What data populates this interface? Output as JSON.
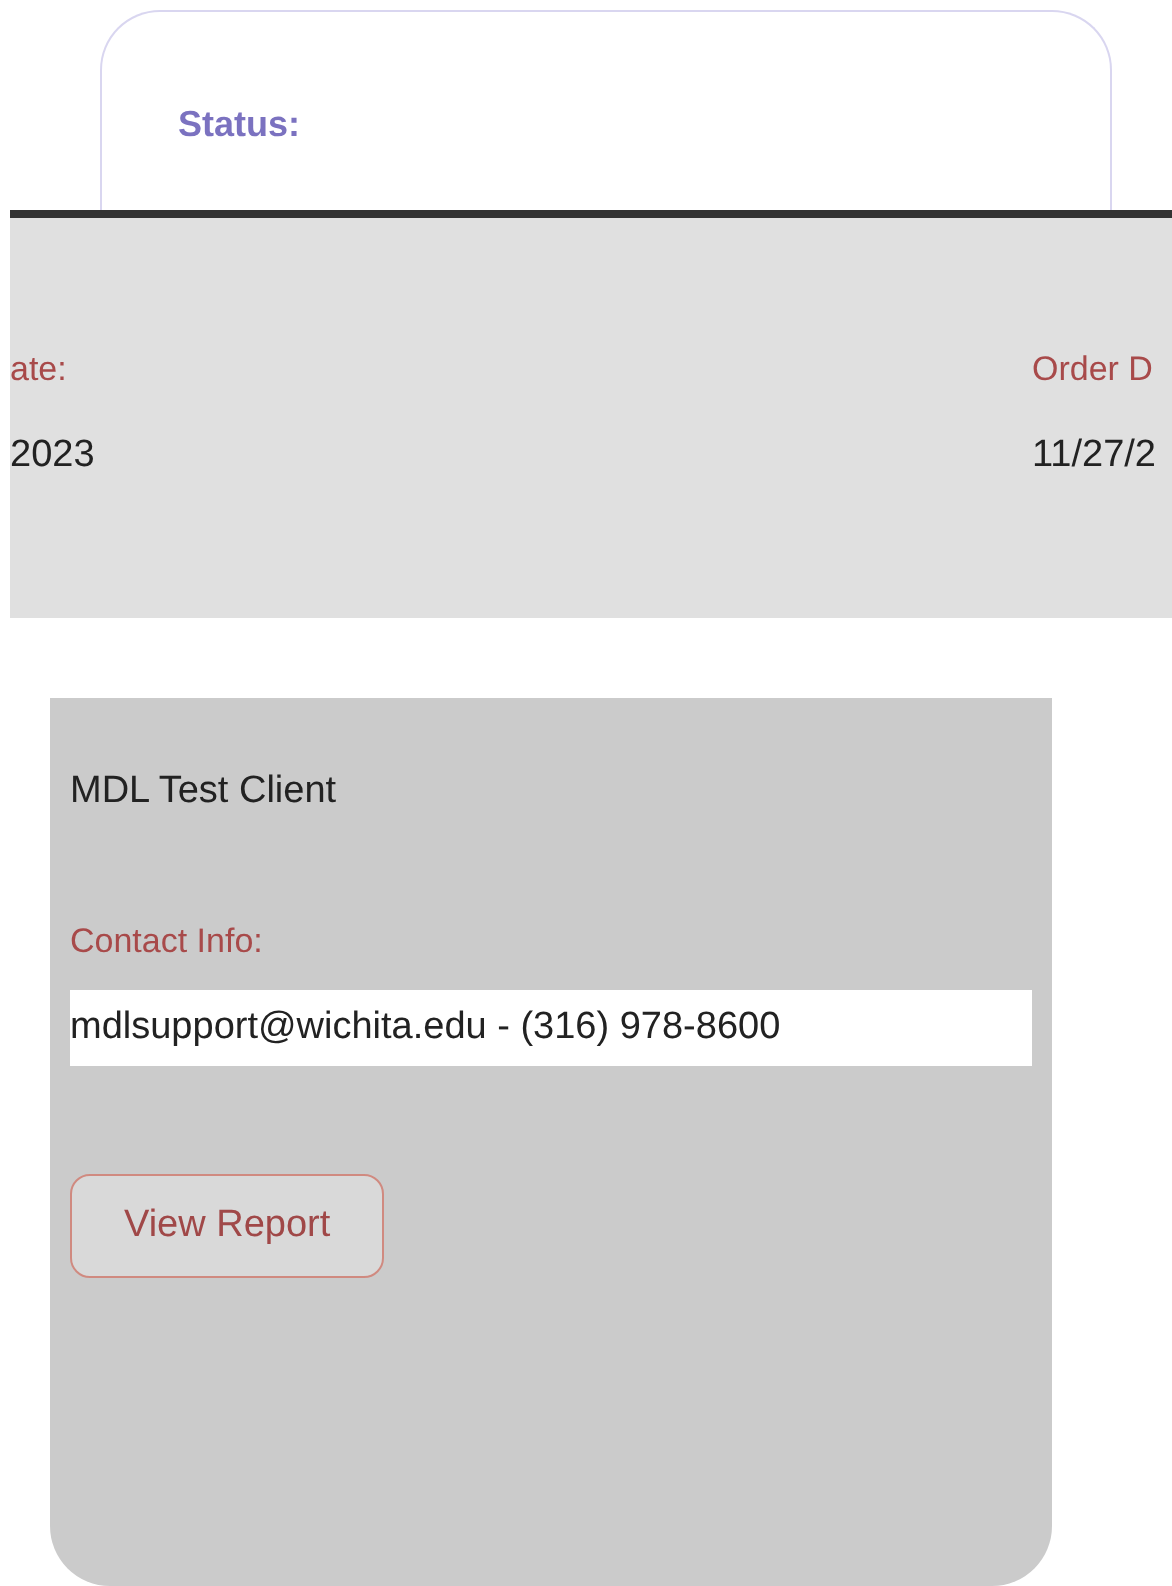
{
  "status_card": {
    "label": "Status:"
  },
  "fields": [
    {
      "label": "ate:",
      "value": "2023"
    },
    {
      "label": "Order D",
      "value": "11/27/2"
    }
  ],
  "client": {
    "value": "MDL Test Client"
  },
  "contact": {
    "label": "Contact Info:",
    "value": "mdlsupport@wichita.edu - (316) 978-8600"
  },
  "buttons": [
    {
      "label": "View Report"
    }
  ]
}
